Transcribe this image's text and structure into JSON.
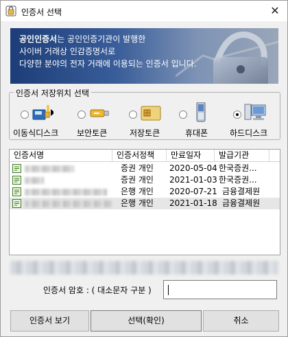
{
  "window": {
    "title": "인증서 선택",
    "close_label": "✕"
  },
  "banner": {
    "line1_bold": "공인인증서",
    "line1_rest": "는 공인인증기관이 발행한",
    "line2": "사이버 거래상 인감증명서로",
    "line3": "다양한 분야의 전자 거래에 이용되는 인증서 입니다."
  },
  "storage": {
    "legend": "인증서 저장위치 선택",
    "options": [
      {
        "label": "이동식디스크",
        "icon": "usb-drive-icon",
        "selected": false
      },
      {
        "label": "보안토큰",
        "icon": "security-token-icon",
        "selected": false
      },
      {
        "label": "저장토큰",
        "icon": "smart-card-icon",
        "selected": false
      },
      {
        "label": "휴대폰",
        "icon": "mobile-phone-icon",
        "selected": false
      },
      {
        "label": "하드디스크",
        "icon": "computer-icon",
        "selected": true
      }
    ]
  },
  "cert_list": {
    "columns": [
      "인증서명",
      "인증서정책",
      "만료일자",
      "발급기관"
    ],
    "rows": [
      {
        "policy": "증권 개인",
        "expiry": "2020-05-04",
        "issuer": "한국증권...",
        "selected": false
      },
      {
        "policy": "증권 개인",
        "expiry": "2021-01-03",
        "issuer": "한국증권...",
        "selected": false
      },
      {
        "policy": "은행 개인",
        "expiry": "2020-07-21",
        "issuer": "금융결제원",
        "selected": false
      },
      {
        "policy": "은행 개인",
        "expiry": "2021-01-18",
        "issuer": "금융결제원",
        "selected": true
      }
    ]
  },
  "password": {
    "label": "인증서 암호 : ( 대소문자 구분 )",
    "value": ""
  },
  "buttons": {
    "view": "인증서 보기",
    "ok": "선택(확인)",
    "cancel": "취소"
  }
}
